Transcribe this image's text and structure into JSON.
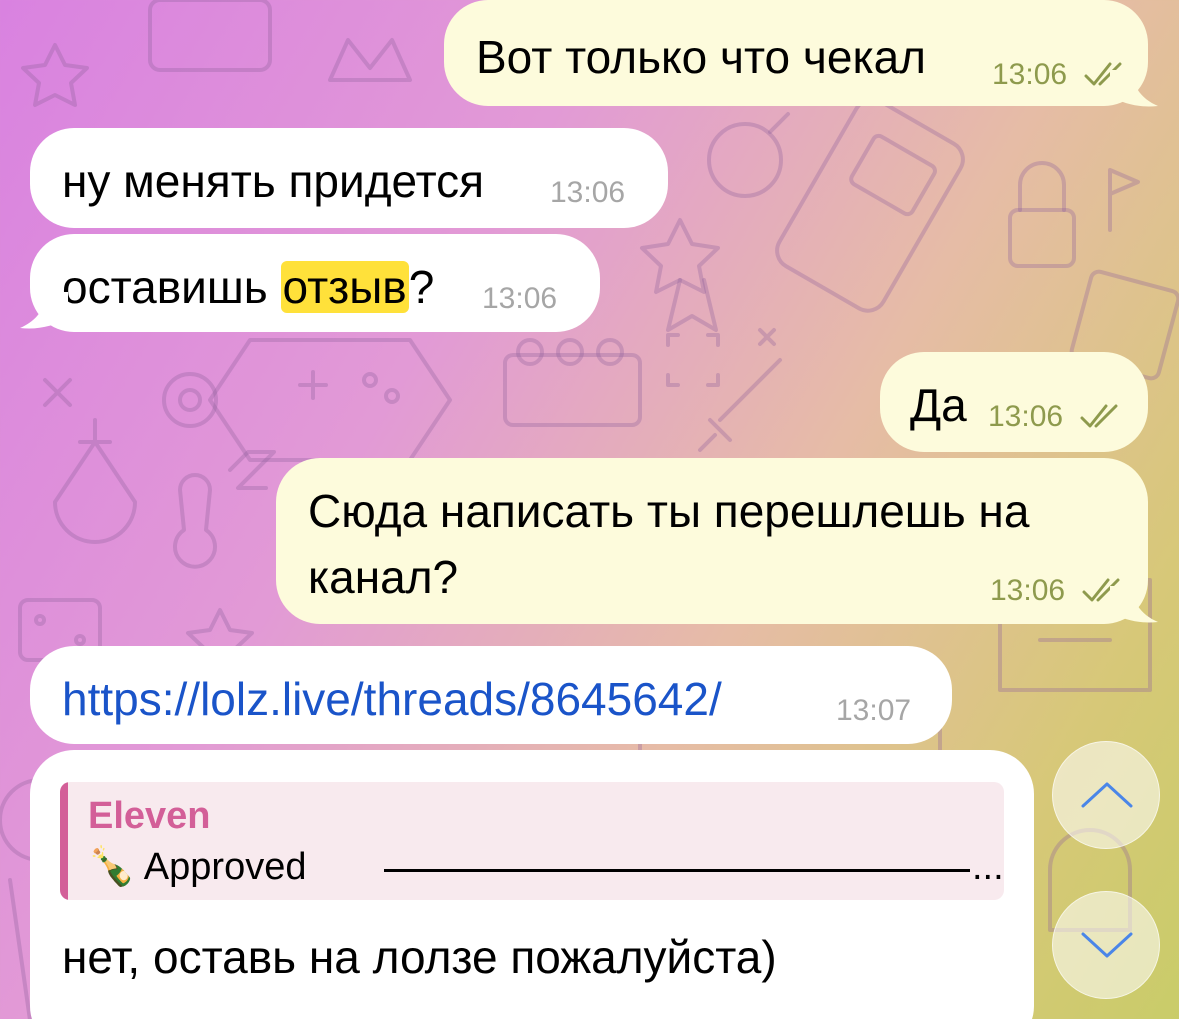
{
  "messages": [
    {
      "id": "m1",
      "direction": "outgoing",
      "text": "Вот только что чекал",
      "time": "13:06",
      "status": "read"
    },
    {
      "id": "m2",
      "direction": "incoming",
      "text": "ну менять придется",
      "time": "13:06"
    },
    {
      "id": "m3",
      "direction": "incoming",
      "text_before": "оставишь ",
      "highlight": "отзыв",
      "text_after": "?",
      "time": "13:06"
    },
    {
      "id": "m4",
      "direction": "outgoing",
      "text": "Да",
      "time": "13:06",
      "status": "read"
    },
    {
      "id": "m5",
      "direction": "outgoing",
      "line1": "Сюда написать ты перешлешь на",
      "line2": "канал?",
      "time": "13:06",
      "status": "read"
    },
    {
      "id": "m6",
      "direction": "incoming",
      "link": "https://lolz.live/threads/8645642/",
      "time": "13:07"
    },
    {
      "id": "m7",
      "direction": "incoming",
      "reply": {
        "author": "Eleven",
        "emoji": "🍾",
        "preview": "Approved",
        "ellipsis": "..."
      },
      "text": "нет, оставь на лолзе пожалуйста)"
    }
  ],
  "controls": {
    "scroll_up_icon": "chevron-up-icon",
    "scroll_down_icon": "chevron-down-icon"
  },
  "colors": {
    "outgoing_bubble": "#fdfbdc",
    "incoming_bubble": "#ffffff",
    "outgoing_meta": "#8e9a4d",
    "incoming_meta": "#a6a6a6",
    "highlight": "#ffe13a",
    "link": "#1a54c9",
    "reply_accent": "#d35f98",
    "control_accent": "#4a86e8"
  }
}
